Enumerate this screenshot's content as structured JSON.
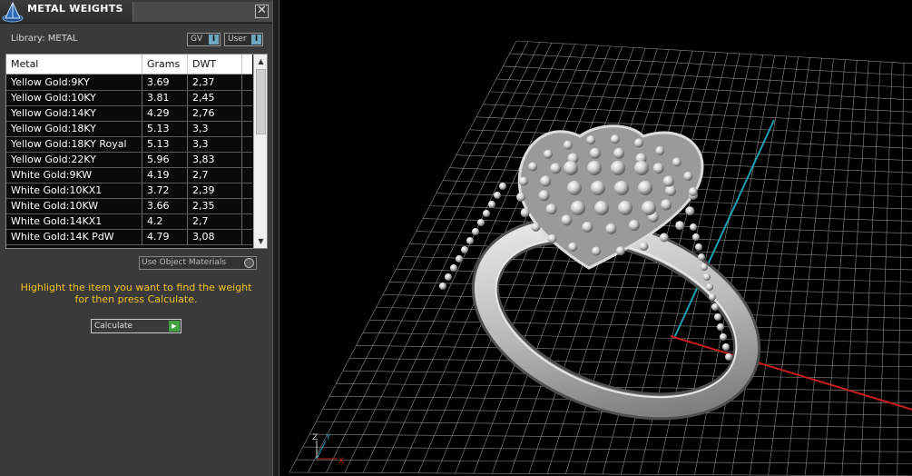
{
  "window": {
    "title": "METAL WEIGHTS",
    "close_glyph": "✕"
  },
  "library": {
    "label": "Library: METAL",
    "toggles": [
      {
        "label": "GV",
        "mark": "I"
      },
      {
        "label": "User",
        "mark": "I"
      }
    ]
  },
  "table": {
    "columns": [
      "Metal",
      "Grams",
      "DWT"
    ],
    "rows": [
      [
        "Yellow Gold:9KY",
        "3.69",
        "2,37"
      ],
      [
        "Yellow Gold:10KY",
        "3.81",
        "2,45"
      ],
      [
        "Yellow Gold:14KY",
        "4.29",
        "2,76"
      ],
      [
        "Yellow Gold:18KY",
        "5.13",
        "3,3"
      ],
      [
        "Yellow Gold:18KY Royal",
        "5.13",
        "3,3"
      ],
      [
        "Yellow Gold:22KY",
        "5.96",
        "3,83"
      ],
      [
        "White Gold:9KW",
        "4.19",
        "2,7"
      ],
      [
        "White Gold:10KX1",
        "3.72",
        "2,39"
      ],
      [
        "White Gold:10KW",
        "3.66",
        "2,35"
      ],
      [
        "White Gold:14KX1",
        "4.2",
        "2,7"
      ],
      [
        "White Gold:14K PdW",
        "4.79",
        "3,08"
      ]
    ],
    "scroll_up_glyph": "▲",
    "scroll_down_glyph": "▼"
  },
  "use_object_materials": {
    "label": "Use Object Materials",
    "selected": false
  },
  "instructions": {
    "line1": "Highlight the item you want to find the weight",
    "line2": "for then press Calculate."
  },
  "calculate": {
    "label": "Calculate",
    "go_glyph": "▶"
  },
  "colors": {
    "panel_bg": "#3a3a3a",
    "instruction_text": "#f2c21b",
    "toggle_mark": "#6fa9c1",
    "calc_go": "#3fa13f",
    "grid_line": "#8a8a8a",
    "axis_x": "#c81e1e",
    "axis_y": "#1e9fb4",
    "ring_metal": "#c8c8c8"
  },
  "icons": {
    "app_logo": "pyramid-logo-icon",
    "close": "close-icon",
    "axis_gizmo": "axis-gizmo-icon"
  },
  "axis_gizmo": {
    "z": "Z",
    "y": "Y",
    "x": "X"
  }
}
